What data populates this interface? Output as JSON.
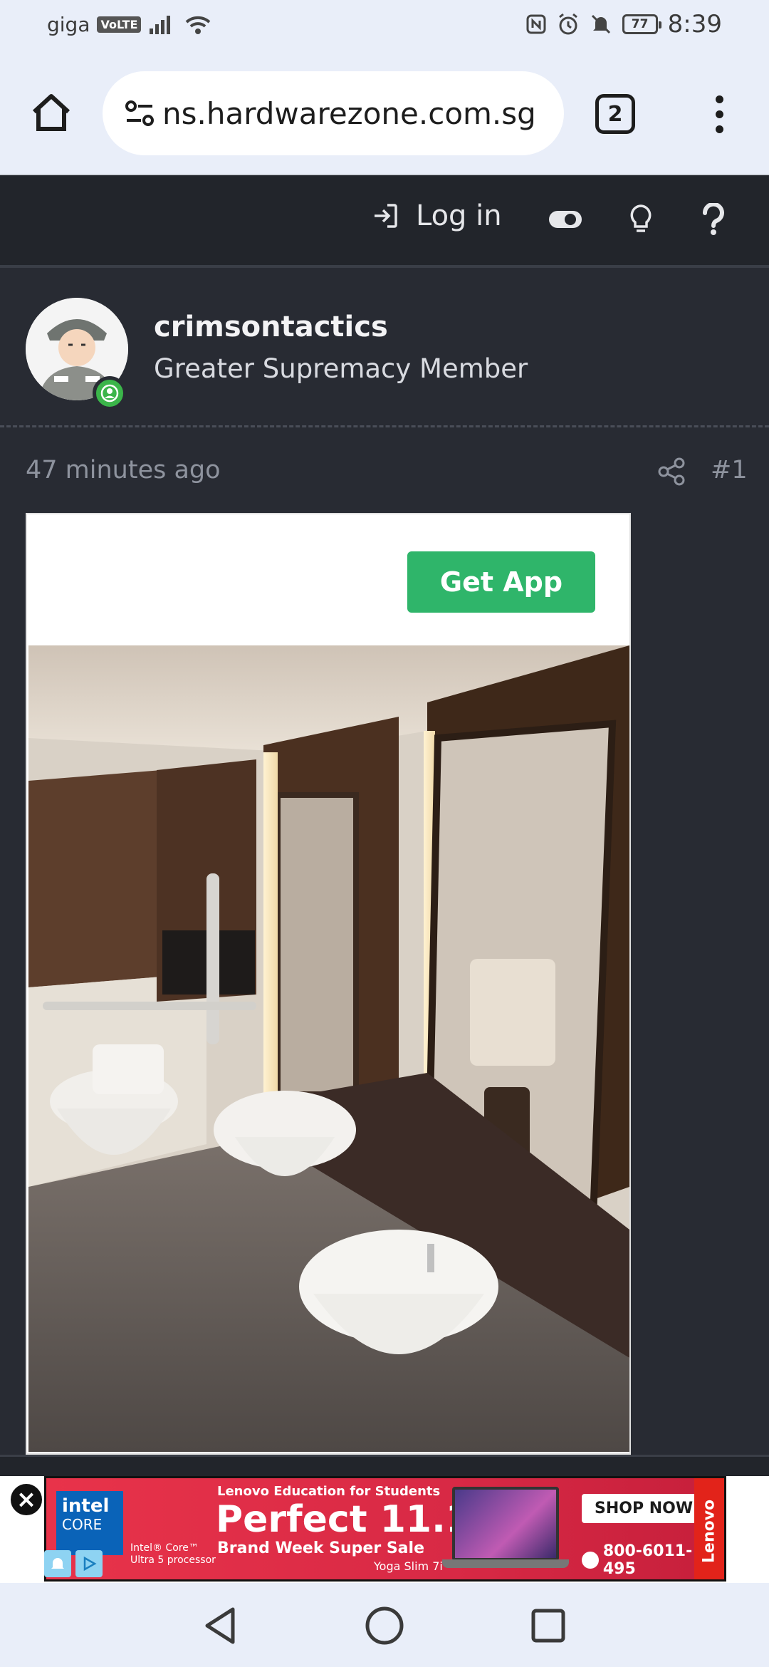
{
  "status_bar": {
    "carrier": "giga",
    "volte": "VoLTE",
    "battery": "77",
    "time": "8:39"
  },
  "browser": {
    "url": "ns.hardwarezone.com.sg",
    "tab_count": "2"
  },
  "site_header": {
    "login_label": "Log in"
  },
  "post": {
    "author": {
      "username": "crimsontactics",
      "title": "Greater Supremacy Member"
    },
    "timestamp": "47 minutes ago",
    "post_number": "#1",
    "embed": {
      "get_app_label": "Get App"
    }
  },
  "ad": {
    "intel_brand": "intel",
    "intel_core": "CORE",
    "intel_sub_line1": "Intel® Core™",
    "intel_sub_line2": "Ultra 5 processor",
    "kicker": "Lenovo Education for Students",
    "headline": "Perfect 11.11",
    "subhead": "Brand Week Super Sale",
    "model": "Yoga Slim 7i",
    "cta": "SHOP NOW",
    "phone": "800-6011-495",
    "brand": "Lenovo"
  },
  "colors": {
    "page_bg": "#282b33",
    "header_bg": "#22252b",
    "get_app_green": "#2fb56a",
    "online_green": "#3bb54a",
    "ad_red": "#d82945"
  }
}
